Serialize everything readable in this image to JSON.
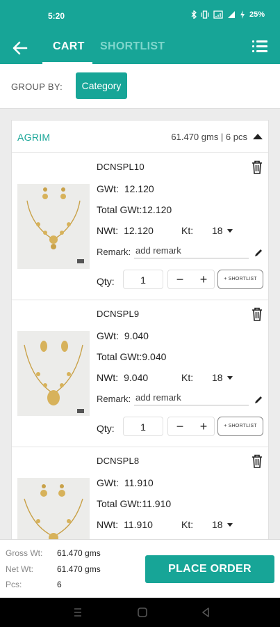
{
  "status_bar": {
    "time": "5:20",
    "battery": "25%",
    "icons": [
      "bluetooth-icon",
      "vibrate-icon",
      "wifi-icon",
      "signal-icon",
      "battery-icon"
    ]
  },
  "header": {
    "back_icon": "arrow-left-icon",
    "tabs": [
      {
        "label": "CART",
        "active": true
      },
      {
        "label": "SHORTLIST",
        "active": false
      }
    ],
    "menu_icon": "list-menu-icon"
  },
  "group_by": {
    "label": "GROUP BY:",
    "selected": "Category"
  },
  "group": {
    "name": "AGRIM",
    "summary": "61.470 gms | 6 pcs"
  },
  "items": [
    {
      "code": "DCNSPL10",
      "gwt_label": "GWt:",
      "gwt": "12.120",
      "total_gwt_label": "Total GWt:",
      "total_gwt": "12.120",
      "nwt_label": "NWt:",
      "nwt": "12.120",
      "kt_label": "Kt:",
      "kt": "18",
      "remark_label": "Remark:",
      "remark_placeholder": "add remark",
      "qty_label": "Qty:",
      "qty": "1",
      "minus": "−",
      "plus": "+",
      "shortlist": "+ SHORTLIST"
    },
    {
      "code": "DCNSPL9",
      "gwt_label": "GWt:",
      "gwt": "9.040",
      "total_gwt_label": "Total GWt:",
      "total_gwt": "9.040",
      "nwt_label": "NWt:",
      "nwt": "9.040",
      "kt_label": "Kt:",
      "kt": "18",
      "remark_label": "Remark:",
      "remark_placeholder": "add remark",
      "qty_label": "Qty:",
      "qty": "1",
      "minus": "−",
      "plus": "+",
      "shortlist": "+ SHORTLIST"
    },
    {
      "code": "DCNSPL8",
      "gwt_label": "GWt:",
      "gwt": "11.910",
      "total_gwt_label": "Total GWt:",
      "total_gwt": "11.910",
      "nwt_label": "NWt:",
      "nwt": "11.910",
      "kt_label": "Kt:",
      "kt": "18"
    }
  ],
  "footer": {
    "gross_label": "Gross Wt:",
    "gross": "61.470 gms",
    "net_label": "Net Wt:",
    "net": "61.470 gms",
    "pcs_label": "Pcs:",
    "pcs": "6",
    "place_order": "PLACE ORDER"
  },
  "colors": {
    "accent": "#17a597",
    "tab_inactive": "#7fd6cc",
    "gold": "#c9a24a"
  }
}
